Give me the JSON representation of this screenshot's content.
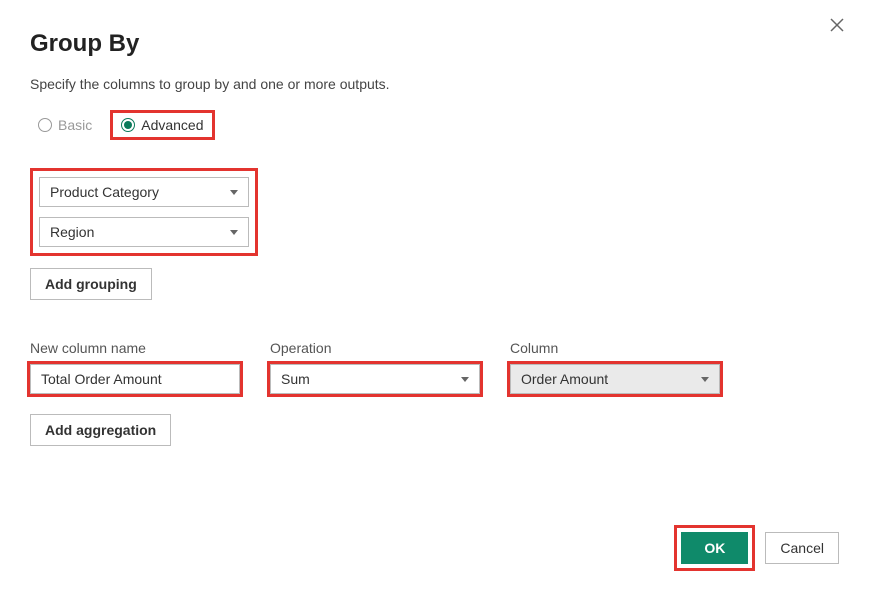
{
  "title": "Group By",
  "subtitle": "Specify the columns to group by and one or more outputs.",
  "mode": {
    "basic": "Basic",
    "advanced": "Advanced",
    "selected": "advanced"
  },
  "groupings": [
    "Product Category",
    "Region"
  ],
  "add_grouping_label": "Add grouping",
  "agg": {
    "new_col_label": "New column name",
    "operation_label": "Operation",
    "column_label": "Column",
    "rows": [
      {
        "name": "Total Order Amount",
        "operation": "Sum",
        "column": "Order Amount"
      }
    ]
  },
  "add_agg_label": "Add aggregation",
  "buttons": {
    "ok": "OK",
    "cancel": "Cancel"
  }
}
